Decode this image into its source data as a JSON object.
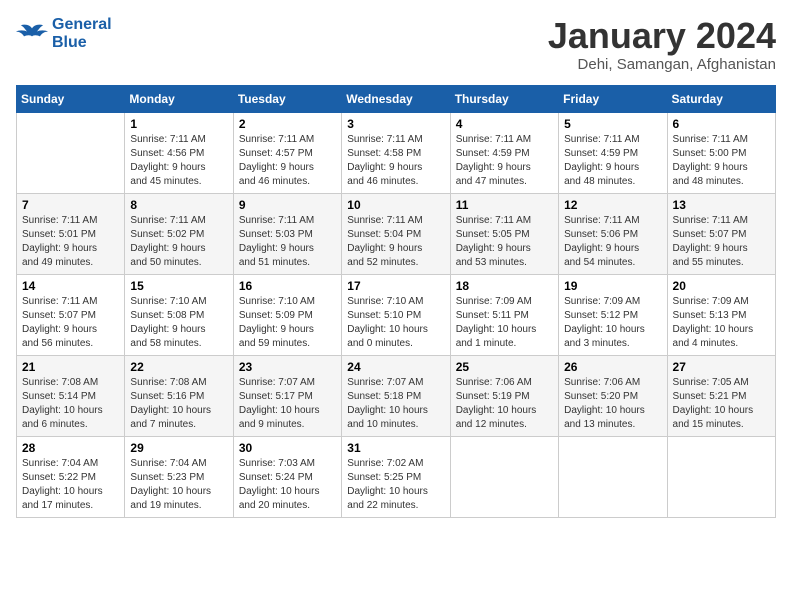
{
  "header": {
    "logo_line1": "General",
    "logo_line2": "Blue",
    "month_title": "January 2024",
    "location": "Dehi, Samangan, Afghanistan"
  },
  "days_of_week": [
    "Sunday",
    "Monday",
    "Tuesday",
    "Wednesday",
    "Thursday",
    "Friday",
    "Saturday"
  ],
  "weeks": [
    [
      {
        "day": "",
        "info": ""
      },
      {
        "day": "1",
        "info": "Sunrise: 7:11 AM\nSunset: 4:56 PM\nDaylight: 9 hours\nand 45 minutes."
      },
      {
        "day": "2",
        "info": "Sunrise: 7:11 AM\nSunset: 4:57 PM\nDaylight: 9 hours\nand 46 minutes."
      },
      {
        "day": "3",
        "info": "Sunrise: 7:11 AM\nSunset: 4:58 PM\nDaylight: 9 hours\nand 46 minutes."
      },
      {
        "day": "4",
        "info": "Sunrise: 7:11 AM\nSunset: 4:59 PM\nDaylight: 9 hours\nand 47 minutes."
      },
      {
        "day": "5",
        "info": "Sunrise: 7:11 AM\nSunset: 4:59 PM\nDaylight: 9 hours\nand 48 minutes."
      },
      {
        "day": "6",
        "info": "Sunrise: 7:11 AM\nSunset: 5:00 PM\nDaylight: 9 hours\nand 48 minutes."
      }
    ],
    [
      {
        "day": "7",
        "info": "Sunrise: 7:11 AM\nSunset: 5:01 PM\nDaylight: 9 hours\nand 49 minutes."
      },
      {
        "day": "8",
        "info": "Sunrise: 7:11 AM\nSunset: 5:02 PM\nDaylight: 9 hours\nand 50 minutes."
      },
      {
        "day": "9",
        "info": "Sunrise: 7:11 AM\nSunset: 5:03 PM\nDaylight: 9 hours\nand 51 minutes."
      },
      {
        "day": "10",
        "info": "Sunrise: 7:11 AM\nSunset: 5:04 PM\nDaylight: 9 hours\nand 52 minutes."
      },
      {
        "day": "11",
        "info": "Sunrise: 7:11 AM\nSunset: 5:05 PM\nDaylight: 9 hours\nand 53 minutes."
      },
      {
        "day": "12",
        "info": "Sunrise: 7:11 AM\nSunset: 5:06 PM\nDaylight: 9 hours\nand 54 minutes."
      },
      {
        "day": "13",
        "info": "Sunrise: 7:11 AM\nSunset: 5:07 PM\nDaylight: 9 hours\nand 55 minutes."
      }
    ],
    [
      {
        "day": "14",
        "info": "Sunrise: 7:11 AM\nSunset: 5:07 PM\nDaylight: 9 hours\nand 56 minutes."
      },
      {
        "day": "15",
        "info": "Sunrise: 7:10 AM\nSunset: 5:08 PM\nDaylight: 9 hours\nand 58 minutes."
      },
      {
        "day": "16",
        "info": "Sunrise: 7:10 AM\nSunset: 5:09 PM\nDaylight: 9 hours\nand 59 minutes."
      },
      {
        "day": "17",
        "info": "Sunrise: 7:10 AM\nSunset: 5:10 PM\nDaylight: 10 hours\nand 0 minutes."
      },
      {
        "day": "18",
        "info": "Sunrise: 7:09 AM\nSunset: 5:11 PM\nDaylight: 10 hours\nand 1 minute."
      },
      {
        "day": "19",
        "info": "Sunrise: 7:09 AM\nSunset: 5:12 PM\nDaylight: 10 hours\nand 3 minutes."
      },
      {
        "day": "20",
        "info": "Sunrise: 7:09 AM\nSunset: 5:13 PM\nDaylight: 10 hours\nand 4 minutes."
      }
    ],
    [
      {
        "day": "21",
        "info": "Sunrise: 7:08 AM\nSunset: 5:14 PM\nDaylight: 10 hours\nand 6 minutes."
      },
      {
        "day": "22",
        "info": "Sunrise: 7:08 AM\nSunset: 5:16 PM\nDaylight: 10 hours\nand 7 minutes."
      },
      {
        "day": "23",
        "info": "Sunrise: 7:07 AM\nSunset: 5:17 PM\nDaylight: 10 hours\nand 9 minutes."
      },
      {
        "day": "24",
        "info": "Sunrise: 7:07 AM\nSunset: 5:18 PM\nDaylight: 10 hours\nand 10 minutes."
      },
      {
        "day": "25",
        "info": "Sunrise: 7:06 AM\nSunset: 5:19 PM\nDaylight: 10 hours\nand 12 minutes."
      },
      {
        "day": "26",
        "info": "Sunrise: 7:06 AM\nSunset: 5:20 PM\nDaylight: 10 hours\nand 13 minutes."
      },
      {
        "day": "27",
        "info": "Sunrise: 7:05 AM\nSunset: 5:21 PM\nDaylight: 10 hours\nand 15 minutes."
      }
    ],
    [
      {
        "day": "28",
        "info": "Sunrise: 7:04 AM\nSunset: 5:22 PM\nDaylight: 10 hours\nand 17 minutes."
      },
      {
        "day": "29",
        "info": "Sunrise: 7:04 AM\nSunset: 5:23 PM\nDaylight: 10 hours\nand 19 minutes."
      },
      {
        "day": "30",
        "info": "Sunrise: 7:03 AM\nSunset: 5:24 PM\nDaylight: 10 hours\nand 20 minutes."
      },
      {
        "day": "31",
        "info": "Sunrise: 7:02 AM\nSunset: 5:25 PM\nDaylight: 10 hours\nand 22 minutes."
      },
      {
        "day": "",
        "info": ""
      },
      {
        "day": "",
        "info": ""
      },
      {
        "day": "",
        "info": ""
      }
    ]
  ]
}
